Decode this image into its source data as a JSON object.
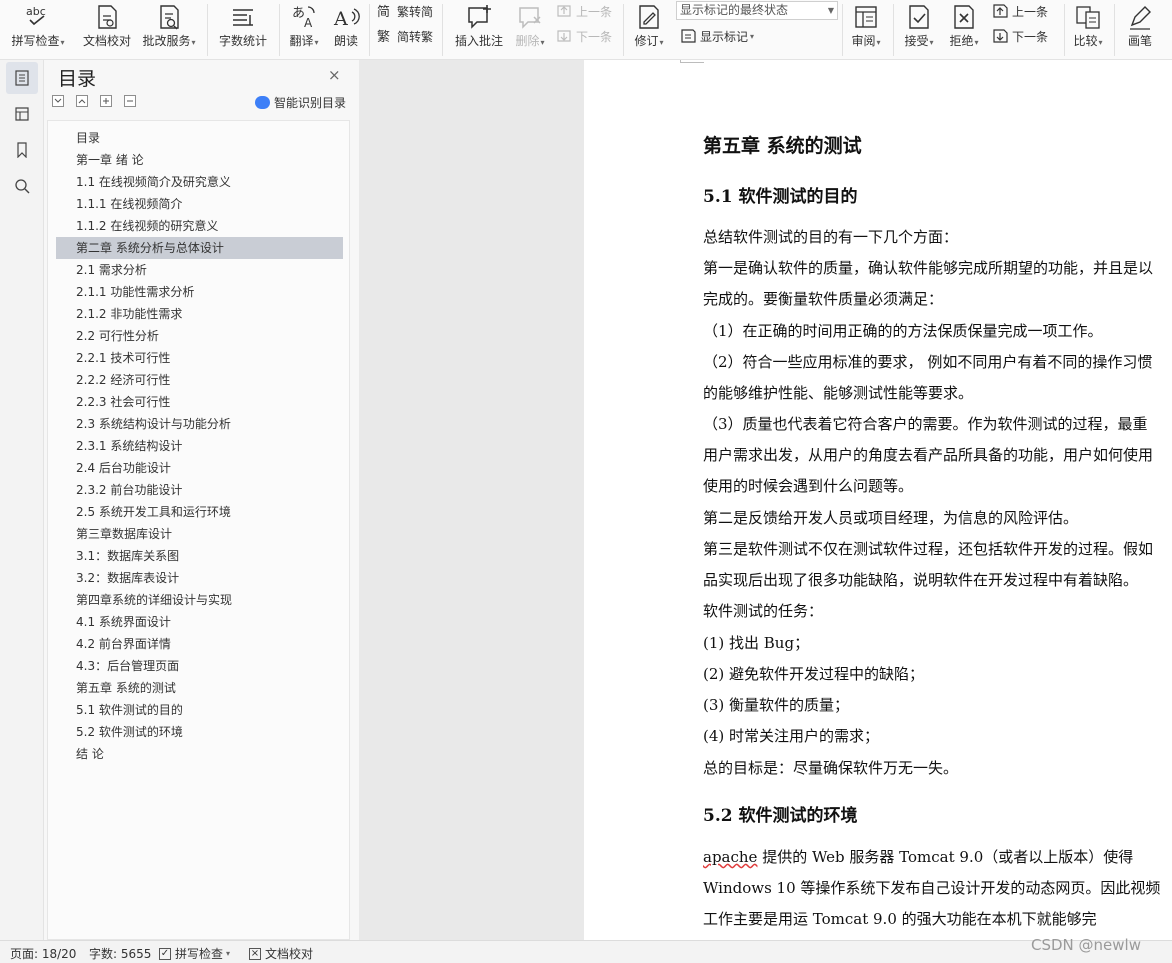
{
  "ribbon": {
    "spell_check": "拼写检查",
    "doc_proof": "文档校对",
    "review_service": "批改服务",
    "word_count": "字数统计",
    "translate": "翻译",
    "read_aloud": "朗读",
    "trad_to_simp": "繁转简",
    "simp_to_trad": "简转繁",
    "insert_comment": "插入批注",
    "delete": "删除",
    "prev_comment": "上一条",
    "next_comment": "下一条",
    "track_changes": "修订",
    "markup_state": "显示标记的最终状态",
    "show_markup": "显示标记",
    "review": "审阅",
    "accept": "接受",
    "reject": "拒绝",
    "prev_change": "上一条",
    "next_change": "下一条",
    "compare": "比较",
    "pen": "画笔",
    "dropdown": "▾"
  },
  "toc": {
    "title": "目录",
    "close": "×",
    "smart_label": "智能识别目录",
    "items": [
      {
        "label": "目录",
        "active": false
      },
      {
        "label": "第一章 绪 论",
        "active": false
      },
      {
        "label": "1.1 在线视频简介及研究意义",
        "active": false
      },
      {
        "label": "1.1.1 在线视频简介",
        "active": false
      },
      {
        "label": "1.1.2 在线视频的研究意义",
        "active": false
      },
      {
        "label": "第二章 系统分析与总体设计",
        "active": true
      },
      {
        "label": "2.1 需求分析",
        "active": false
      },
      {
        "label": "2.1.1 功能性需求分析",
        "active": false
      },
      {
        "label": "2.1.2 非功能性需求",
        "active": false
      },
      {
        "label": "2.2 可行性分析",
        "active": false
      },
      {
        "label": "2.2.1 技术可行性",
        "active": false
      },
      {
        "label": "2.2.2 经济可行性",
        "active": false
      },
      {
        "label": "2.2.3 社会可行性",
        "active": false
      },
      {
        "label": "2.3 系统结构设计与功能分析",
        "active": false
      },
      {
        "label": "2.3.1 系统结构设计",
        "active": false
      },
      {
        "label": "2.4 后台功能设计",
        "active": false
      },
      {
        "label": "2.3.2 前台功能设计",
        "active": false
      },
      {
        "label": "2.5 系统开发工具和运行环境",
        "active": false
      },
      {
        "label": "第三章数据库设计",
        "active": false
      },
      {
        "label": "3.1：数据库关系图",
        "active": false
      },
      {
        "label": "3.2：数据库表设计",
        "active": false
      },
      {
        "label": "第四章系统的详细设计与实现",
        "active": false
      },
      {
        "label": "4.1 系统界面设计",
        "active": false
      },
      {
        "label": "4.2 前台界面详情",
        "active": false
      },
      {
        "label": "4.3：后台管理页面",
        "active": false
      },
      {
        "label": "第五章 系统的测试",
        "active": false
      },
      {
        "label": "5.1 软件测试的目的",
        "active": false
      },
      {
        "label": "5.2 软件测试的环境",
        "active": false
      },
      {
        "label": "结 论",
        "active": false
      }
    ]
  },
  "document": {
    "chapter_title": "第五章  系统的测试",
    "sec51_title": "5.1  软件测试的目的",
    "lines": [
      "总结软件测试的目的有一下几个方面：",
      "第一是确认软件的质量，确认软件能够完成所期望的功能，并且是以",
      "完成的。要衡量软件质量必须满足：",
      "（1）在正确的时间用正确的的方法保质保量完成一项工作。",
      "（2）符合一些应用标准的要求，  例如不同用户有着不同的操作习惯",
      "的能够维护性能、能够测试性能等要求。",
      "（3）质量也代表着它符合客户的需要。作为软件测试的过程，最重",
      "用户需求出发，从用户的角度去看产品所具备的功能，用户如何使用",
      "使用的时候会遇到什么问题等。",
      "第二是反馈给开发人员或项目经理，为信息的风险评估。",
      "第三是软件测试不仅在测试软件过程，还包括软件开发的过程。假如",
      "品实现后出现了很多功能缺陷，说明软件在开发过程中有着缺陷。",
      "软件测试的任务：",
      "(1)  找出  Bug；",
      "(2)  避免软件开发过程中的缺陷；",
      "(3)  衡量软件的质量；",
      "(4)  时常关注用户的需求；",
      "总的目标是：尽量确保软件万无一失。"
    ],
    "sec52_title": "5.2  软件测试的环境",
    "env_word": "apache",
    "env_lines": [
      " 提供的  Web 服务器  Tomcat 9.0（或者以上版本）使得",
      "Windows 10 等操作系统下发布自己设计开发的动态网页。因此视频",
      "工作主要是用运  Tomcat 9.0  的强大功能在本机下就能够完"
    ]
  },
  "status": {
    "page": "页面: 18/20",
    "words": "字数: 5655",
    "spell_check": "拼写检查",
    "doc_proof": "文档校对"
  },
  "watermark": "CSDN @newlw",
  "colors": {
    "accent": "#3d7ff7",
    "active_toc": "#c9cdd5",
    "spell_error": "#e03c3c"
  }
}
